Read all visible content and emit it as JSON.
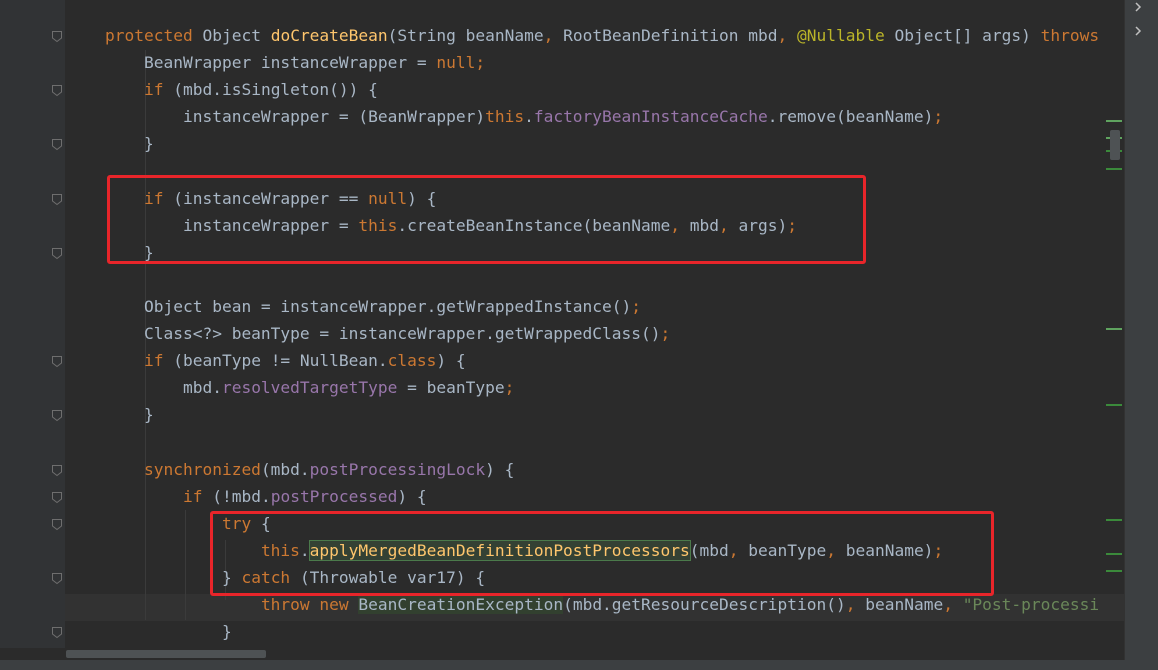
{
  "editor": {
    "lines": [
      {
        "tokens": [
          {
            "t": "protected ",
            "c": "kw"
          },
          {
            "t": "Object "
          },
          {
            "t": "doCreateBean",
            "c": "fn"
          },
          {
            "t": "(String beanName"
          },
          {
            "t": ", ",
            "c": "kw"
          },
          {
            "t": "RootBeanDefinition mbd"
          },
          {
            "t": ", ",
            "c": "kw"
          },
          {
            "t": "@Nullable",
            "c": "ann"
          },
          {
            "t": " Object[] args) "
          },
          {
            "t": "throws",
            "c": "kw"
          }
        ]
      },
      {
        "tokens": [
          {
            "t": "    BeanWrapper instanceWrapper = "
          },
          {
            "t": "null",
            "c": "kw"
          },
          {
            "t": ";",
            "c": "kw"
          }
        ]
      },
      {
        "tokens": [
          {
            "t": "    "
          },
          {
            "t": "if ",
            "c": "kw"
          },
          {
            "t": "(mbd.isSingleton()) {"
          }
        ]
      },
      {
        "tokens": [
          {
            "t": "        instanceWrapper = (BeanWrapper)"
          },
          {
            "t": "this",
            "c": "kw"
          },
          {
            "t": "."
          },
          {
            "t": "factoryBeanInstanceCache",
            "c": "fld"
          },
          {
            "t": ".remove(beanName)"
          },
          {
            "t": ";",
            "c": "kw"
          }
        ]
      },
      {
        "tokens": [
          {
            "t": "    }"
          }
        ]
      },
      {
        "tokens": []
      },
      {
        "tokens": [
          {
            "t": "    "
          },
          {
            "t": "if ",
            "c": "kw"
          },
          {
            "t": "(instanceWrapper == "
          },
          {
            "t": "null",
            "c": "kw"
          },
          {
            "t": ") {"
          }
        ]
      },
      {
        "tokens": [
          {
            "t": "        instanceWrapper = "
          },
          {
            "t": "this",
            "c": "kw"
          },
          {
            "t": ".createBeanInstance(beanName"
          },
          {
            "t": ", ",
            "c": "kw"
          },
          {
            "t": "mbd"
          },
          {
            "t": ", ",
            "c": "kw"
          },
          {
            "t": "args)"
          },
          {
            "t": ";",
            "c": "kw"
          }
        ]
      },
      {
        "tokens": [
          {
            "t": "    }"
          }
        ]
      },
      {
        "tokens": []
      },
      {
        "tokens": [
          {
            "t": "    Object bean = instanceWrapper.getWrappedInstance()"
          },
          {
            "t": ";",
            "c": "kw"
          }
        ]
      },
      {
        "tokens": [
          {
            "t": "    Class<?> beanType = instanceWrapper.getWrappedClass()"
          },
          {
            "t": ";",
            "c": "kw"
          }
        ]
      },
      {
        "tokens": [
          {
            "t": "    "
          },
          {
            "t": "if ",
            "c": "kw"
          },
          {
            "t": "(beanType != NullBean."
          },
          {
            "t": "class",
            "c": "kw"
          },
          {
            "t": ") {"
          }
        ]
      },
      {
        "tokens": [
          {
            "t": "        mbd."
          },
          {
            "t": "resolvedTargetType",
            "c": "fld"
          },
          {
            "t": " = beanType"
          },
          {
            "t": ";",
            "c": "kw"
          }
        ]
      },
      {
        "tokens": [
          {
            "t": "    }"
          }
        ]
      },
      {
        "tokens": []
      },
      {
        "tokens": [
          {
            "t": "    "
          },
          {
            "t": "synchronized",
            "c": "kw"
          },
          {
            "t": "(mbd."
          },
          {
            "t": "postProcessingLock",
            "c": "fld"
          },
          {
            "t": ") {"
          }
        ]
      },
      {
        "tokens": [
          {
            "t": "        "
          },
          {
            "t": "if ",
            "c": "kw"
          },
          {
            "t": "(!mbd."
          },
          {
            "t": "postProcessed",
            "c": "fld"
          },
          {
            "t": ") {"
          }
        ]
      },
      {
        "tokens": [
          {
            "t": "            "
          },
          {
            "t": "try ",
            "c": "kw"
          },
          {
            "t": "{"
          }
        ]
      },
      {
        "tokens": [
          {
            "t": "                "
          },
          {
            "t": "this",
            "c": "kw"
          },
          {
            "t": "."
          },
          {
            "t": "applyMergedBeanDefinitionPostProcessors",
            "c": "fn hl-sel"
          },
          {
            "t": "(mbd"
          },
          {
            "t": ", ",
            "c": "kw"
          },
          {
            "t": "beanType"
          },
          {
            "t": ", ",
            "c": "kw"
          },
          {
            "t": "beanName)"
          },
          {
            "t": ";",
            "c": "kw"
          }
        ]
      },
      {
        "tokens": [
          {
            "t": "            } "
          },
          {
            "t": "catch ",
            "c": "kw"
          },
          {
            "t": "(Throwable var17) {"
          }
        ]
      },
      {
        "tokens": [
          {
            "t": "                "
          },
          {
            "t": "throw new ",
            "c": "kw"
          },
          {
            "t": "BeanCreationException",
            "c": "hl-ref"
          },
          {
            "t": "(mbd.getResourceDescription()"
          },
          {
            "t": ", ",
            "c": "kw"
          },
          {
            "t": "beanName"
          },
          {
            "t": ", ",
            "c": "kw"
          },
          {
            "t": "\"Post-processi",
            "c": "str"
          }
        ]
      },
      {
        "tokens": [
          {
            "t": "            }"
          }
        ]
      }
    ]
  }
}
